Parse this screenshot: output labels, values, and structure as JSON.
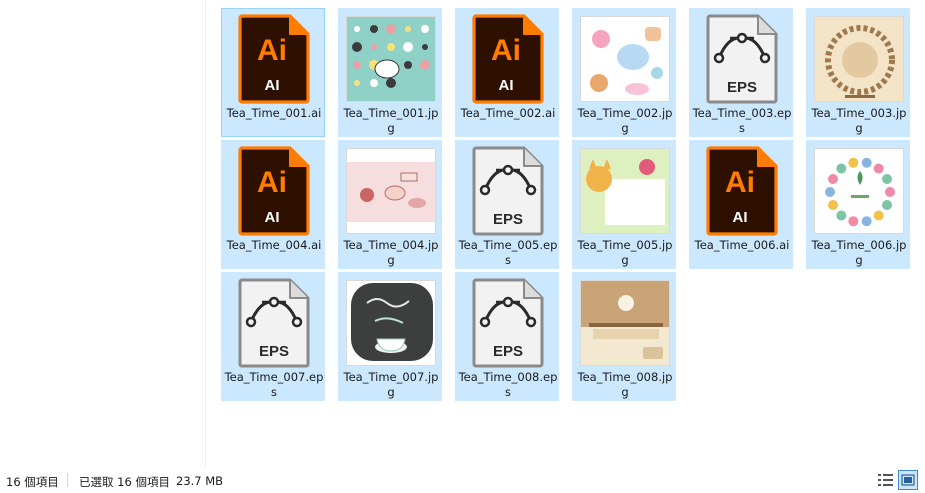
{
  "files": [
    {
      "name": "Tea_Time_001.ai",
      "type": "ai"
    },
    {
      "name": "Tea_Time_001.jpg",
      "type": "jpg",
      "thumb": "teal-icons"
    },
    {
      "name": "Tea_Time_002.ai",
      "type": "ai"
    },
    {
      "name": "Tea_Time_002.jpg",
      "type": "jpg",
      "thumb": "pastel-sweets"
    },
    {
      "name": "Tea_Time_003.eps",
      "type": "eps"
    },
    {
      "name": "Tea_Time_003.jpg",
      "type": "jpg",
      "thumb": "sepia-circle"
    },
    {
      "name": "Tea_Time_004.ai",
      "type": "ai"
    },
    {
      "name": "Tea_Time_004.jpg",
      "type": "jpg",
      "thumb": "pink-tea-set"
    },
    {
      "name": "Tea_Time_005.eps",
      "type": "eps"
    },
    {
      "name": "Tea_Time_005.jpg",
      "type": "jpg",
      "thumb": "cat-card"
    },
    {
      "name": "Tea_Time_006.ai",
      "type": "ai"
    },
    {
      "name": "Tea_Time_006.jpg",
      "type": "jpg",
      "thumb": "floral-wreath"
    },
    {
      "name": "Tea_Time_007.eps",
      "type": "eps"
    },
    {
      "name": "Tea_Time_007.jpg",
      "type": "jpg",
      "thumb": "chalk-we-love-tea"
    },
    {
      "name": "Tea_Time_008.eps",
      "type": "eps"
    },
    {
      "name": "Tea_Time_008.jpg",
      "type": "jpg",
      "thumb": "shelf-scene"
    }
  ],
  "icons": {
    "ai_label_big": "Ai",
    "ai_label_small": "AI",
    "eps_label": "EPS"
  },
  "status": {
    "count": "16 個項目",
    "selected": "已選取 16 個項目",
    "size": "23.7 MB"
  },
  "colors": {
    "selection": "#cce8ff",
    "ai_orange": "#ff7c00",
    "ai_dark": "#2e1000"
  }
}
